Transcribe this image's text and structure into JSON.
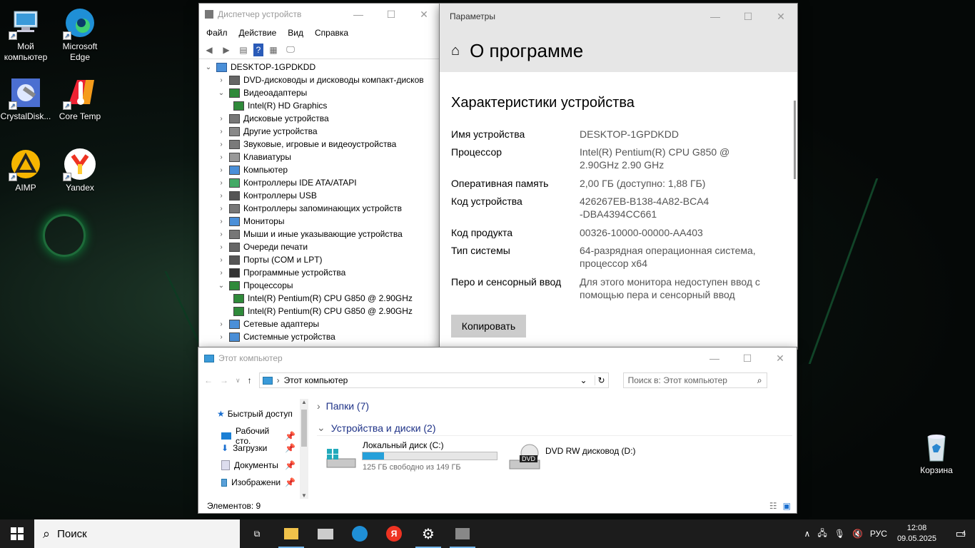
{
  "desktop": {
    "icons": [
      {
        "label": "Мой компьютер"
      },
      {
        "label": "Microsoft Edge"
      },
      {
        "label": "CrystalDisk..."
      },
      {
        "label": "Core Temp"
      },
      {
        "label": "AIMP"
      },
      {
        "label": "Yandex"
      },
      {
        "label": "Корзина"
      }
    ]
  },
  "devmgr": {
    "title": "Диспетчер устройств",
    "menu": [
      "Файл",
      "Действие",
      "Вид",
      "Справка"
    ],
    "root": "DESKTOP-1GPDKDD",
    "items": [
      {
        "label": "DVD-дисководы и дисководы компакт-дисков",
        "expanded": false,
        "depth": 1
      },
      {
        "label": "Видеоадаптеры",
        "expanded": true,
        "depth": 1
      },
      {
        "label": "Intel(R) HD Graphics",
        "depth": 2
      },
      {
        "label": "Дисковые устройства",
        "expanded": false,
        "depth": 1
      },
      {
        "label": "Другие устройства",
        "expanded": false,
        "depth": 1
      },
      {
        "label": "Звуковые, игровые и видеоустройства",
        "expanded": false,
        "depth": 1
      },
      {
        "label": "Клавиатуры",
        "expanded": false,
        "depth": 1
      },
      {
        "label": "Компьютер",
        "expanded": false,
        "depth": 1
      },
      {
        "label": "Контроллеры IDE ATA/ATAPI",
        "expanded": false,
        "depth": 1
      },
      {
        "label": "Контроллеры USB",
        "expanded": false,
        "depth": 1
      },
      {
        "label": "Контроллеры запоминающих устройств",
        "expanded": false,
        "depth": 1
      },
      {
        "label": "Мониторы",
        "expanded": false,
        "depth": 1
      },
      {
        "label": "Мыши и иные указывающие устройства",
        "expanded": false,
        "depth": 1
      },
      {
        "label": "Очереди печати",
        "expanded": false,
        "depth": 1
      },
      {
        "label": "Порты (COM и LPT)",
        "expanded": false,
        "depth": 1
      },
      {
        "label": "Программные устройства",
        "expanded": false,
        "depth": 1
      },
      {
        "label": "Процессоры",
        "expanded": true,
        "depth": 1
      },
      {
        "label": "Intel(R) Pentium(R) CPU G850 @ 2.90GHz",
        "depth": 2
      },
      {
        "label": "Intel(R) Pentium(R) CPU G850 @ 2.90GHz",
        "depth": 2
      },
      {
        "label": "Сетевые адаптеры",
        "expanded": false,
        "depth": 1
      },
      {
        "label": "Системные устройства",
        "expanded": false,
        "depth": 1
      }
    ]
  },
  "settings": {
    "title": "Параметры",
    "page_title": "О программе",
    "section_title": "Характеристики устройства",
    "specs": [
      {
        "key": "Имя устройства",
        "value": "DESKTOP-1GPDKDD"
      },
      {
        "key": "Процессор",
        "value": "Intel(R) Pentium(R) CPU G850 @ 2.90GHz 2.90 GHz"
      },
      {
        "key": "Оперативная память",
        "value": "2,00 ГБ (доступно: 1,88 ГБ)"
      },
      {
        "key": "Код устройства",
        "value": "426267EB-B138-4A82-BCA4-DBA4394CC661"
      },
      {
        "key": "Код продукта",
        "value": "00326-10000-00000-AA403"
      },
      {
        "key": "Тип системы",
        "value": "64-разрядная операционная система, процессор x64"
      },
      {
        "key": "Перо и сенсорный ввод",
        "value": "Для этого монитора недоступен ввод с помощью пера и сенсорный ввод"
      }
    ],
    "copy_button": "Копировать"
  },
  "explorer": {
    "title": "Этот компьютер",
    "address": "Этот компьютер",
    "search_placeholder": "Поиск в: Этот компьютер",
    "nav": [
      {
        "label": "Быстрый доступ"
      },
      {
        "label": "Рабочий сто."
      },
      {
        "label": "Загрузки"
      },
      {
        "label": "Документы"
      },
      {
        "label": "Изображени"
      }
    ],
    "groups": [
      {
        "label": "Папки (7)"
      },
      {
        "label": "Устройства и диски (2)"
      }
    ],
    "drives": [
      {
        "name": "Локальный диск (C:)",
        "free_text": "125 ГБ свободно из 149 ГБ",
        "used_fraction": 0.16
      },
      {
        "name": "DVD RW дисковод (D:)",
        "badge": "DVD"
      }
    ],
    "status": "Элементов: 9"
  },
  "taskbar": {
    "search_label": "Поиск",
    "lang": "РУС",
    "time": "12:08",
    "date": "09.05.2025",
    "notif_count": "4",
    "yandex_glyph": "Я"
  },
  "colors": {
    "accent": "#0078d7",
    "progress": "#26a0da"
  }
}
